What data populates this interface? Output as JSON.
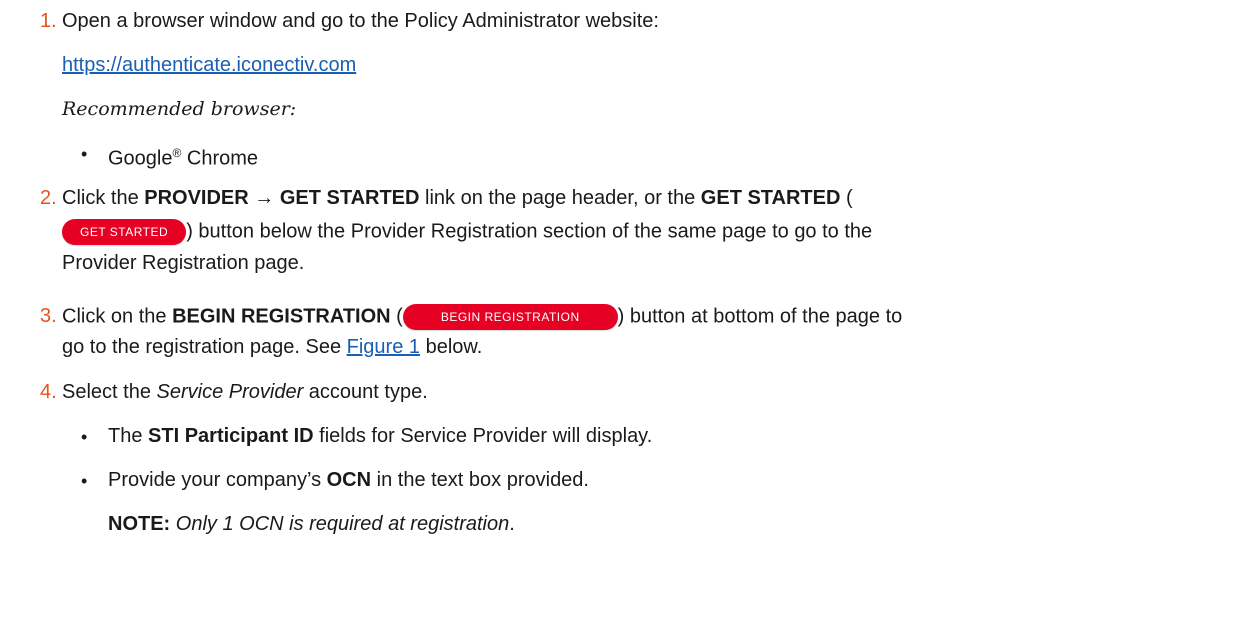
{
  "steps": {
    "s1": {
      "num": "1.",
      "text": "Open a browser window and go to the  Policy Administrator website:",
      "url": "https://authenticate.iconectiv.com",
      "browser_heading": "Recommended browser:",
      "bullet_main": "Google",
      "bullet_reg": "®",
      "bullet_tail": " Chrome"
    },
    "s2": {
      "num": "2.",
      "t1": "Click the ",
      "b1": "PROVIDER → GET STARTED",
      "t2": "  link on the page header, or the ",
      "b2": "GET STARTED",
      "t3": " (",
      "btn": "GET STARTED",
      "t4": ") button below the Provider Registration section of the same page to go to the",
      "t5": "Provider Registration page."
    },
    "s3": {
      "num": "3.",
      "t1": "Click on the ",
      "b1": "BEGIN REGISTRATION",
      "t2": " (",
      "btn": "BEGIN REGISTRATION",
      "t3": ") button at bottom of the page to",
      "t4": "go to the registration page. See ",
      "link": "Figure 1",
      "t5": " below."
    },
    "s4": {
      "num": "4.",
      "t1": "Select the ",
      "i1": "Service Provider",
      "t2": " account type.",
      "bullet1_t1": "The ",
      "bullet1_b": "STI Participant ID",
      "bullet1_t2": " fields for Service Provider will display.",
      "bullet2_t1": "Provide your company’s ",
      "bullet2_b": "OCN",
      "bullet2_t2": " in the text box provided.",
      "note_label": "NOTE:",
      "note_text": " Only 1 OCN is required at registration",
      "note_end": "."
    }
  },
  "colors": {
    "number": "#e8521f",
    "link": "#1a5fb4",
    "button": "#e60024"
  }
}
